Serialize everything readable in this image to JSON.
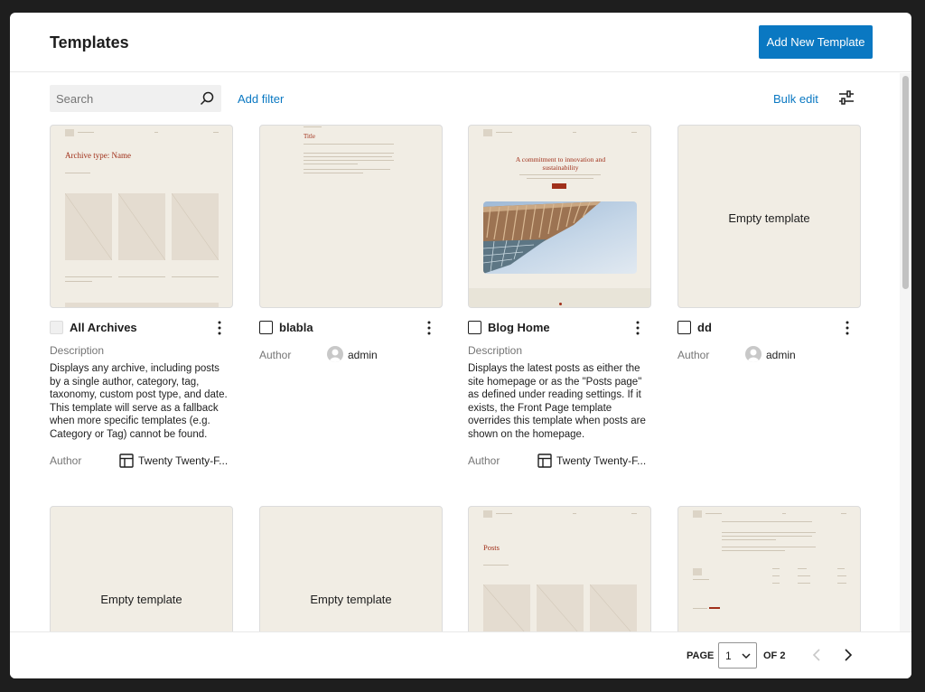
{
  "header": {
    "title": "Templates",
    "add_button": "Add New Template"
  },
  "toolbar": {
    "search_placeholder": "Search",
    "add_filter": "Add filter",
    "bulk_edit": "Bulk edit"
  },
  "cards": [
    {
      "title": "All Archives",
      "description_label": "Description",
      "description": "Displays any archive, including posts by a single author, category, tag, taxonomy, custom post type, and date. This template will serve as a fallback when more specific templates (e.g. Category or Tag) cannot be found.",
      "author_label": "Author",
      "author": "Twenty Twenty-F...",
      "thumb_title": "Archive type: Name"
    },
    {
      "title": "blabla",
      "author_label": "Author",
      "author": "admin",
      "thumb_title": "Title"
    },
    {
      "title": "Blog Home",
      "description_label": "Description",
      "description": "Displays the latest posts as either the site homepage or as the \"Posts page\" as defined under reading settings. If it exists, the Front Page template overrides this template when posts are shown on the homepage.",
      "author_label": "Author",
      "author": "Twenty Twenty-F...",
      "thumb_title": "A commitment to innovation and sustainability"
    },
    {
      "title": "dd",
      "author_label": "Author",
      "author": "admin",
      "empty_label": "Empty template"
    }
  ],
  "row2": [
    {
      "empty_label": "Empty template"
    },
    {
      "empty_label": "Empty template"
    },
    {
      "thumb_title": "Posts"
    },
    {}
  ],
  "pagination": {
    "page_label": "PAGE",
    "current_page": "1",
    "of_label": "OF 2"
  },
  "colors": {
    "accent": "#0a78c2",
    "thumb_bg": "#f1ede4",
    "thumb_red": "#a0301a"
  }
}
